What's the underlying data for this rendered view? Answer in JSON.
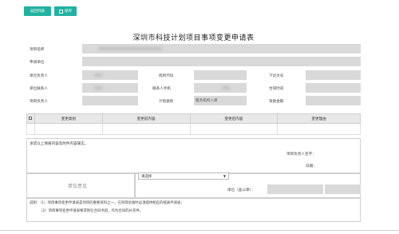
{
  "toolbar": {
    "back_label": "返回列表",
    "save_label": "保存"
  },
  "form": {
    "title": "深圳市科技计划项目事项变更申请表",
    "project_name_label": "项目名称",
    "applicant_unit_label": "申请单位",
    "unit_head_label": "单位负责人",
    "org_code_label": "机构代码",
    "doc_no_label": "下达文号",
    "unit_contact_label": "单位联系人",
    "contact_phone_label": "联系人手机",
    "contract_time_label": "合同时间",
    "project_lead_label": "项目负责人",
    "plan_category_label": "计划类别",
    "plan_category_value": "服务机构入库",
    "funding_label": "资助金额"
  },
  "changes_table": {
    "headers": [
      "变更类别",
      "变更前内容",
      "变更后内容",
      "变更理由"
    ]
  },
  "statement": {
    "text": "承诺以上填报内容及附件内容属实。",
    "signature_label": "项目负责人签字：",
    "date_label": "日期："
  },
  "unit_opinion": {
    "label": "单位意见",
    "select_value": "请选择",
    "stamp_label": "单位（盖公章）："
  },
  "notes": {
    "prefix": "说明：",
    "line1": "（1）项目事项变更申请表是项目的重要资料之一，在项目验收时必须提供相应的纸质申请表；",
    "line2": "（2）项目事项变更申请表要求附在合同书后，作为合同的补充件。"
  }
}
